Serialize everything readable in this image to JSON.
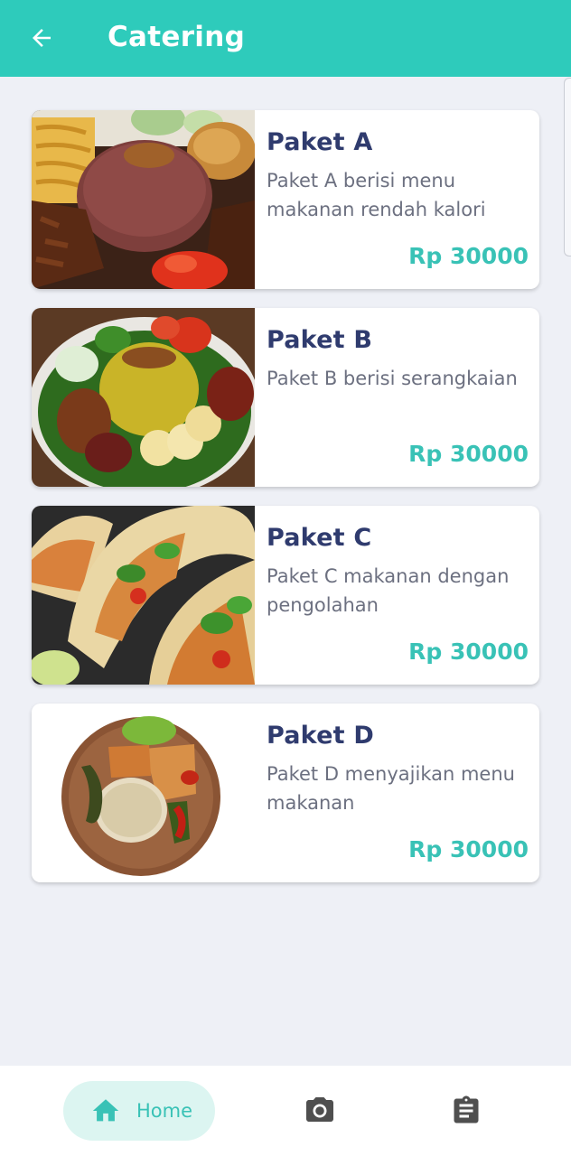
{
  "app": {
    "title": "Catering",
    "back_icon": "arrow-left-icon",
    "colors": {
      "primary": "#2ecbbb",
      "accent": "#39c2b6",
      "title_text": "#2f3b6e",
      "body_text": "#6c7080",
      "background": "#eef0f6"
    }
  },
  "packages": [
    {
      "title": "Paket A",
      "description": "Paket A berisi menu makanan rendah kalori",
      "price": "Rp 30000",
      "image": "nasi-merah-rice-plate"
    },
    {
      "title": "Paket B",
      "description": "Paket B berisi serangkaian",
      "price": "Rp 30000",
      "image": "nasi-kuning-plate"
    },
    {
      "title": "Paket C",
      "description": "Paket C makanan dengan pengolahan",
      "price": "Rp 30000",
      "image": "tacos-plate"
    },
    {
      "title": "Paket D",
      "description": "Paket D menyajikan menu makanan",
      "price": "Rp 30000",
      "image": "rice-wooden-plate"
    }
  ],
  "bottom_nav": {
    "home_label": "Home",
    "home_icon": "home-icon",
    "camera_icon": "camera-icon",
    "clipboard_icon": "clipboard-icon"
  }
}
